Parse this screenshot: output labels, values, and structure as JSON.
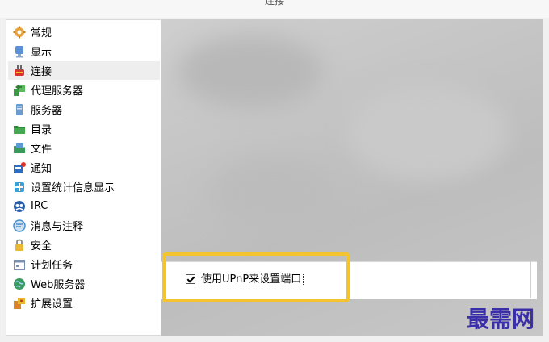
{
  "window": {
    "title": "连接"
  },
  "sidebar": {
    "items": [
      {
        "label": "常规",
        "icon": "gear-icon",
        "color": "#e8a33c"
      },
      {
        "label": "显示",
        "icon": "monitor-icon",
        "color": "#5b8fd6"
      },
      {
        "label": "连接",
        "icon": "plug-icon",
        "color": "#d9342b",
        "selected": true
      },
      {
        "label": "代理服务器",
        "icon": "proxy-icon",
        "color": "#3d9a45"
      },
      {
        "label": "服务器",
        "icon": "server-icon",
        "color": "#6b9bd1"
      },
      {
        "label": "目录",
        "icon": "folder-icon",
        "color": "#2e8b3a"
      },
      {
        "label": "文件",
        "icon": "file-icon",
        "color": "#3a9a5a"
      },
      {
        "label": "通知",
        "icon": "notification-icon",
        "color": "#2b6cc4"
      },
      {
        "label": "设置统计信息显示",
        "icon": "statistics-icon",
        "color": "#3aa0d8"
      },
      {
        "label": "IRC",
        "icon": "irc-icon",
        "color": "#2a5fa8"
      },
      {
        "label": "消息与注释",
        "icon": "message-icon",
        "color": "#4a8fd0"
      },
      {
        "label": "安全",
        "icon": "lock-icon",
        "color": "#e8b830"
      },
      {
        "label": "计划任务",
        "icon": "calendar-icon",
        "color": "#7a8fb0"
      },
      {
        "label": "Web服务器",
        "icon": "globe-icon",
        "color": "#3a9a60"
      },
      {
        "label": "扩展设置",
        "icon": "extension-icon",
        "color": "#d8832a"
      }
    ]
  },
  "connection": {
    "upnp_checkbox": {
      "label": "使用UPnP来设置端口",
      "checked": true
    }
  },
  "watermark": {
    "text": "最需网"
  },
  "colors": {
    "highlight": "#f4c430",
    "selected_bg": "#eeeeee",
    "watermark": "#3a2fa8"
  }
}
